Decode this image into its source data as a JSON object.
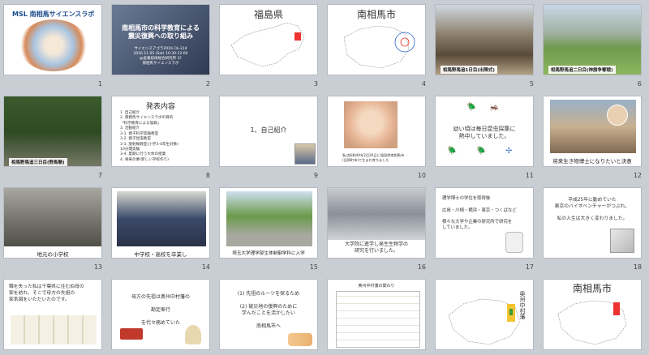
{
  "slides": [
    {
      "n": "1",
      "title": "MSL 南相馬サイエンスラボ"
    },
    {
      "n": "2",
      "title": "南相馬市の科学教育による\n震災復興への取り組み",
      "sub": "サイエンスアゴラ2016 Cb-314\n2016.11.05 (Sat) 10:30-12:00\n@産業技術総合研究所 1F\n南相馬サイエンスラボ"
    },
    {
      "n": "3",
      "title": "福島県"
    },
    {
      "n": "4",
      "title": "南相馬市"
    },
    {
      "n": "5",
      "caption": "相馬野馬追1日目(出陣式)"
    },
    {
      "n": "6",
      "caption": "相馬野馬追二日目(神旗争奪戦)"
    },
    {
      "n": "7",
      "caption": "相馬野馬追三日目(野馬懸)"
    },
    {
      "n": "8",
      "title": "発表内容",
      "body": "1. 自己紹介\n2. 南相馬サイエンスラボの目的\n 「科学教育による復興」\n3. 活動紹介\n 3-1. 親子科学実験教室\n 3-2. 親子昆虫教室\n 3-3. 放射線教室(小学3-4年生対象)\n 10分間実験\n 3-4. 夏期に行う大体の授業\n4. 将来の夢(新しい学校作り)"
    },
    {
      "n": "9",
      "title": "1、自己紹介"
    },
    {
      "n": "10",
      "caption": "私は昭和49年2月26日に福島県南相馬市\n(旧原町市)で生まれ育ちました"
    },
    {
      "n": "11",
      "title": "幼い頃は毎日昆虫採集に\n熱中していました。"
    },
    {
      "n": "12",
      "caption": "将来生き物博士になりたいと決意"
    },
    {
      "n": "13",
      "caption": "地元の小学校"
    },
    {
      "n": "14",
      "caption": "中学校・高校を卒業し"
    },
    {
      "n": "15",
      "caption": "埼玉大学理学部生体制御学科に入学"
    },
    {
      "n": "16",
      "caption": "大学院に進学し発生生物学の\n研究を行いました。"
    },
    {
      "n": "17",
      "body": "理学博士の学位を取得後\n\n広島・川崎・横浜・東京・つくばなど\n\n様々な大学や企業の研究所で研究を\nしていました。"
    },
    {
      "n": "18",
      "body": "平成25年に勤めていた\n東京のバイオベンチャーがつぶれ、\n\n私の人生は大きく変わりました。"
    },
    {
      "n": "19",
      "body": "職を失った私は千葉県に住む伯母の\n家を訪れ、そこで母方の先祖の\n家系図をいただいたのです。"
    },
    {
      "n": "20",
      "body": "母方の先祖は奥州中村藩の\n\n勘定奉行\n\nを代々務めていた"
    },
    {
      "n": "21",
      "body": "(1) 先祖のルーツを探るため\n\n(2) 被災地の復興のために\n学んだことを活かしたい\n\n南相馬市へ"
    },
    {
      "n": "22",
      "title": "奥州中村藩の関わり"
    },
    {
      "n": "23",
      "title": "奥州中村藩"
    },
    {
      "n": "24",
      "title": "南相馬市"
    }
  ],
  "colors": {
    "bg": "#c9cdd4",
    "accent": "#e33333",
    "title_bg": "#3b4a6b"
  }
}
